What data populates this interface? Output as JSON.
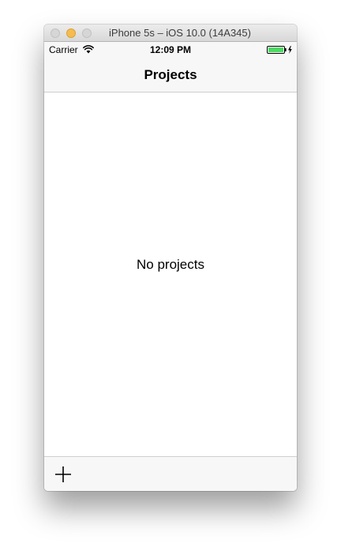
{
  "window": {
    "title": "iPhone 5s – iOS 10.0 (14A345)"
  },
  "status_bar": {
    "carrier": "Carrier",
    "time": "12:09 PM",
    "battery_color": "#4cd964"
  },
  "nav_bar": {
    "title": "Projects"
  },
  "content": {
    "empty_message": "No projects"
  },
  "toolbar": {
    "add_icon": "plus-icon"
  }
}
